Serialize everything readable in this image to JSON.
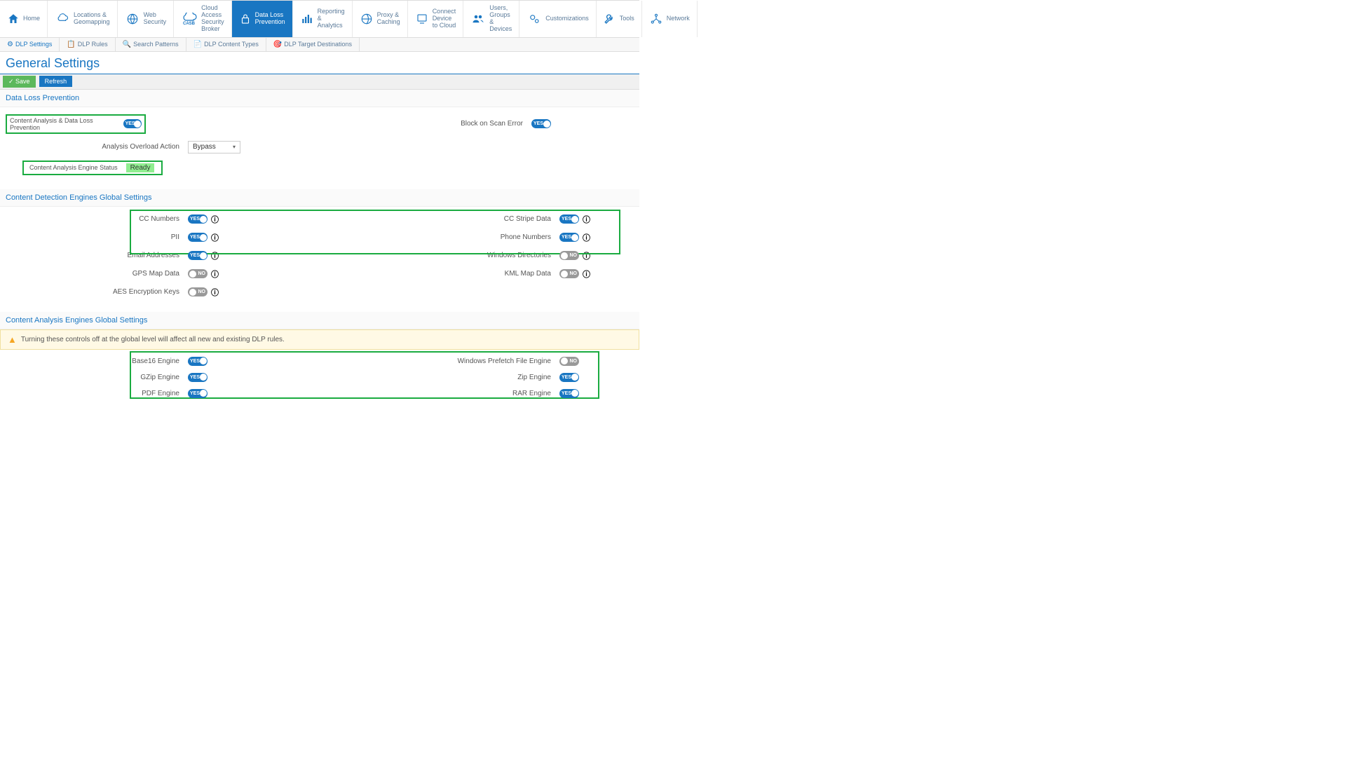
{
  "nav": {
    "home": "Home",
    "items": [
      {
        "label": "Locations &\nGeomapping"
      },
      {
        "label": "Web Security"
      },
      {
        "label": "Cloud Access\nSecurity Broker"
      },
      {
        "label": "Data Loss\nPrevention"
      },
      {
        "label": "Reporting &\nAnalytics"
      },
      {
        "label": "Proxy &\nCaching"
      },
      {
        "label": "Connect Device\nto Cloud"
      },
      {
        "label": "Users, Groups\n& Devices"
      },
      {
        "label": "Customizations"
      },
      {
        "label": "Tools"
      },
      {
        "label": "Network"
      }
    ]
  },
  "subnav": {
    "items": [
      "DLP Settings",
      "DLP Rules",
      "Search Patterns",
      "DLP Content Types",
      "DLP Target Destinations"
    ]
  },
  "page_title": "General Settings",
  "buttons": {
    "save": "Save",
    "refresh": "Refresh"
  },
  "section1": {
    "title": "Data Loss Prevention",
    "row1": {
      "left": "Content Analysis & Data Loss Prevention",
      "right": "Block on Scan Error"
    },
    "row2": {
      "left": "Analysis Overload Action",
      "select": "Bypass"
    },
    "row3": {
      "left": "Content Analysis Engine Status",
      "status": "Ready"
    }
  },
  "section2": {
    "title": "Content Detection Engines Global Settings",
    "rows": [
      {
        "l": "CC Numbers",
        "lv": "on",
        "r": "CC Stripe Data",
        "rv": "on"
      },
      {
        "l": "PII",
        "lv": "on",
        "r": "Phone Numbers",
        "rv": "on"
      },
      {
        "l": "Email Addresses",
        "lv": "on",
        "r": "Windows Directories",
        "rv": "off"
      },
      {
        "l": "GPS Map Data",
        "lv": "off",
        "r": "KML Map Data",
        "rv": "off"
      },
      {
        "l": "AES Encryption Keys",
        "lv": "off",
        "r": "",
        "rv": ""
      }
    ]
  },
  "section3": {
    "title": "Content Analysis Engines Global Settings",
    "warning": "Turning these controls off at the global level will affect all new and existing DLP rules.",
    "rows": [
      {
        "l": "Base16 Engine",
        "lv": "on",
        "r": "Windows Prefetch File Engine",
        "rv": "off"
      },
      {
        "l": "GZip Engine",
        "lv": "on",
        "r": "Zip Engine",
        "rv": "on"
      },
      {
        "l": "PDF Engine",
        "lv": "on",
        "r": "RAR Engine",
        "rv": "on"
      }
    ]
  },
  "toggle_text": {
    "on": "YES",
    "off": "NO"
  }
}
